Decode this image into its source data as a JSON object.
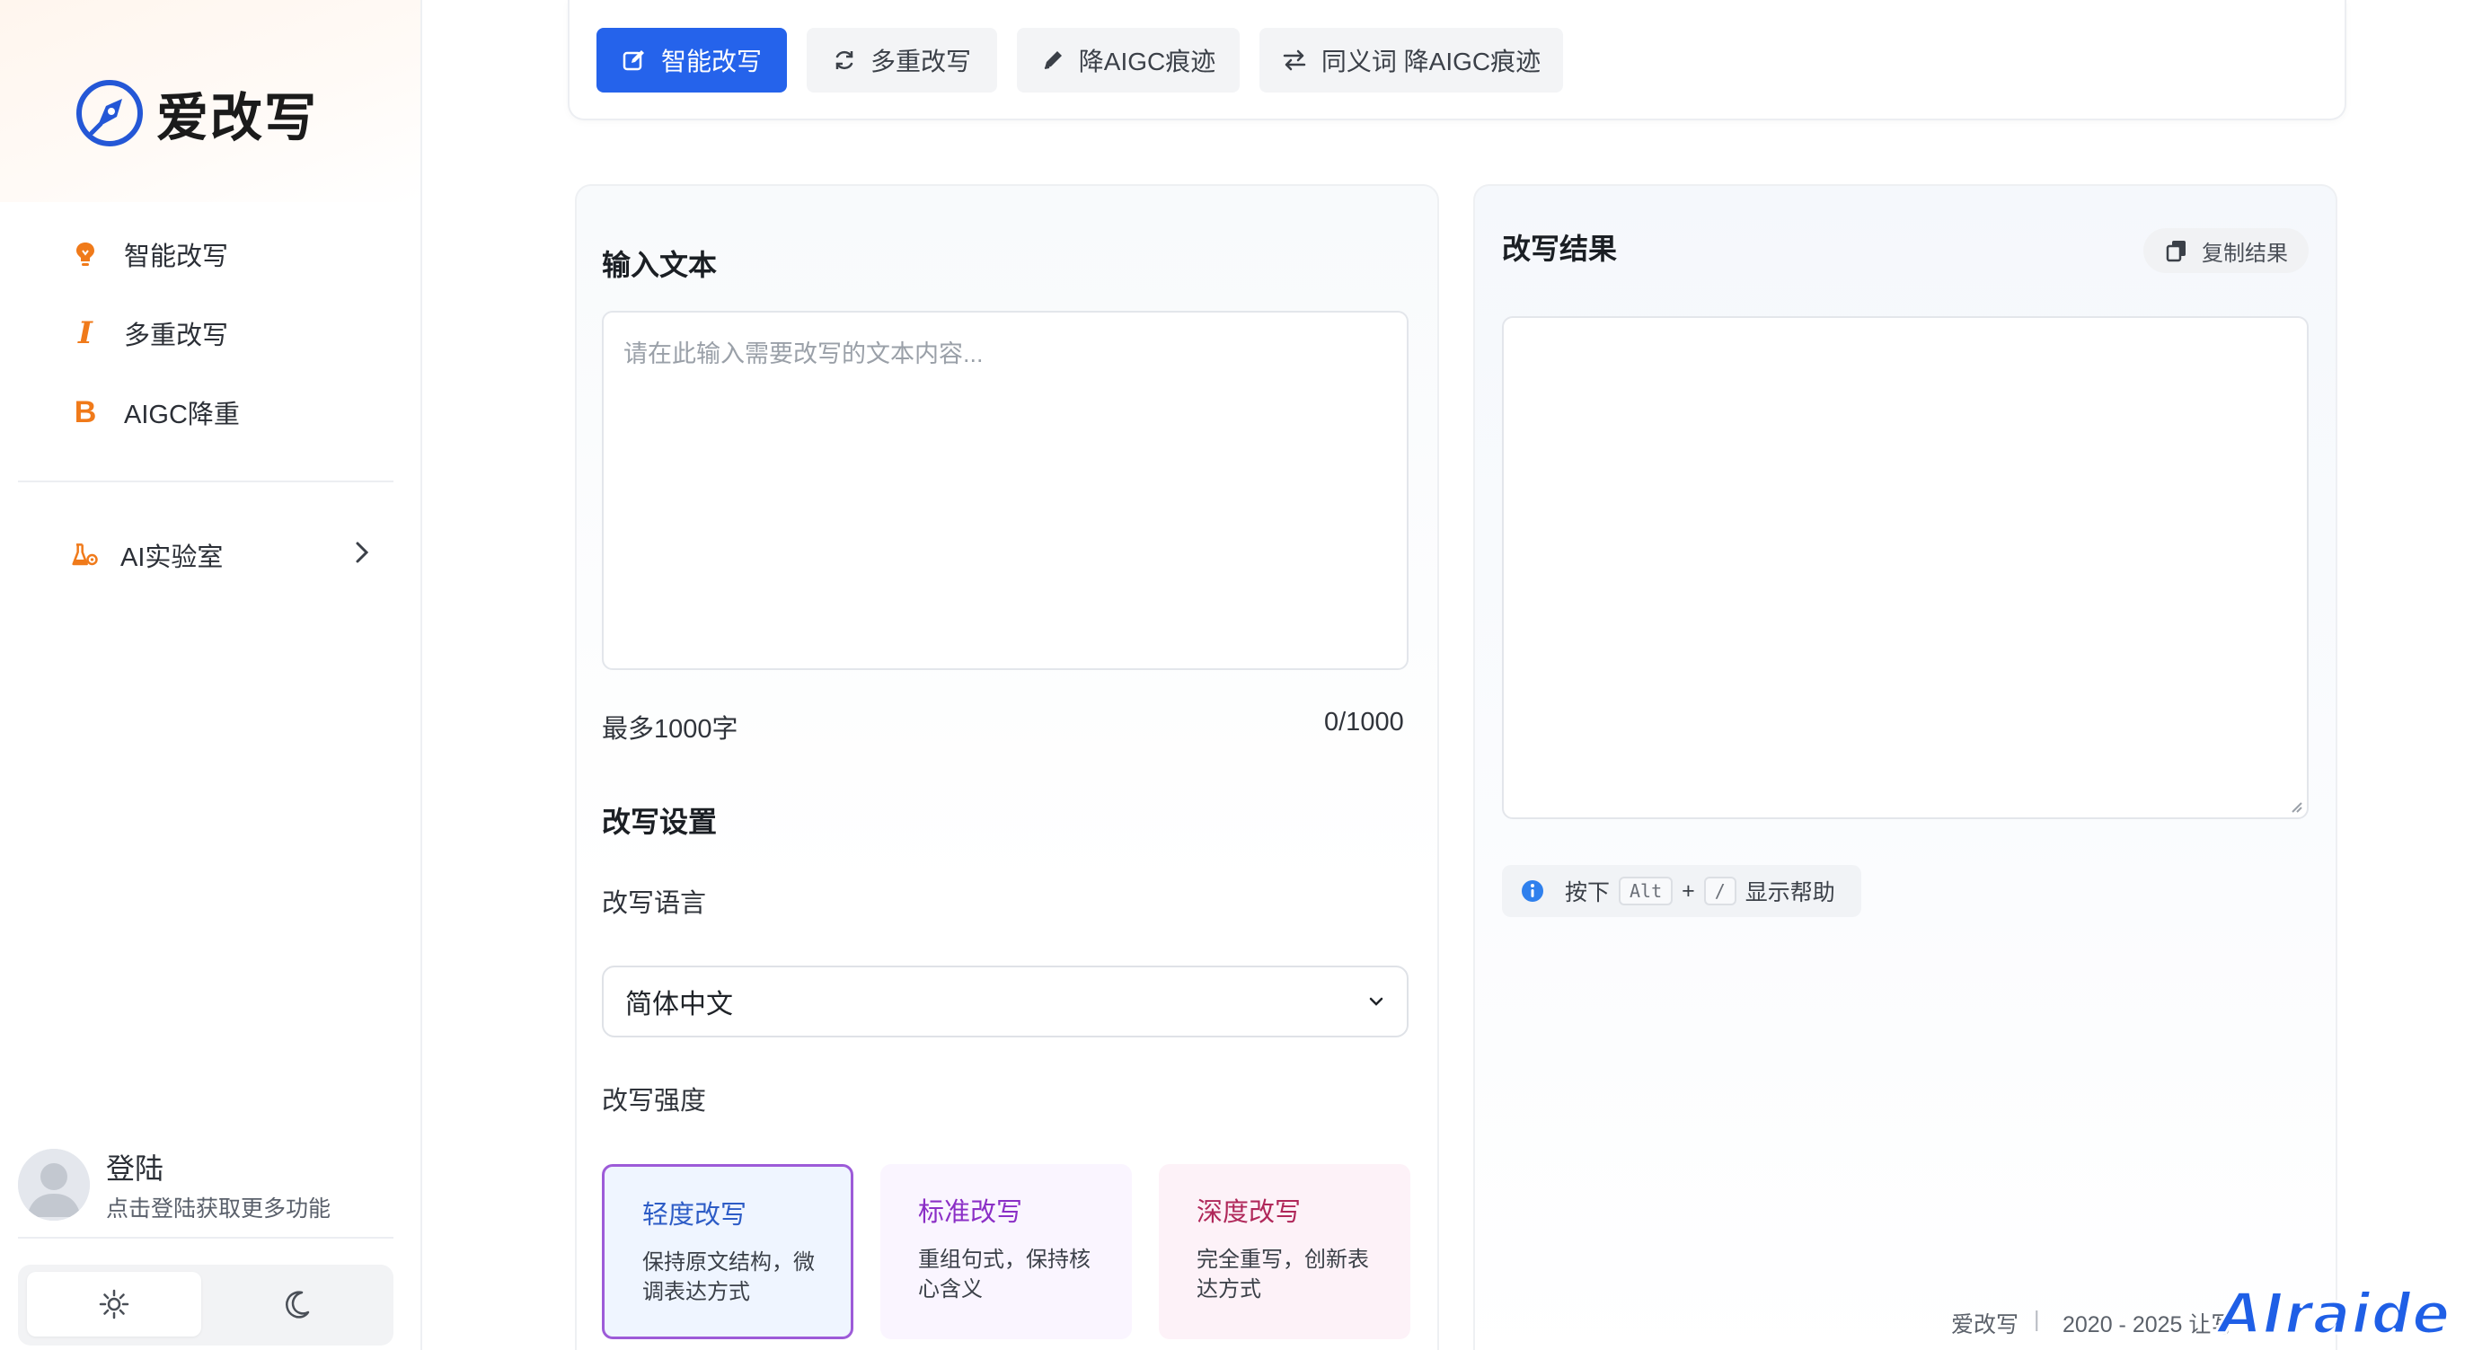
{
  "app": {
    "name": "爱改写",
    "accent_color": "#2563eb",
    "brand_orange": "#f07a1a"
  },
  "sidebar": {
    "items": [
      {
        "label": "智能改写",
        "icon": "lightbulb-icon"
      },
      {
        "label": "多重改写",
        "icon": "italic-icon"
      },
      {
        "label": "AIGC降重",
        "icon": "bold-icon"
      }
    ],
    "lab": {
      "label": "AI实验室",
      "icon": "flask-gear-icon"
    },
    "user": {
      "name": "登陆",
      "subtitle": "点击登陆获取更多功能"
    },
    "theme": {
      "options": [
        "light",
        "dark"
      ],
      "selected": "light"
    }
  },
  "tabs": [
    {
      "label": "智能改写",
      "icon": "edit-icon",
      "active": true
    },
    {
      "label": "多重改写",
      "icon": "refresh-icon",
      "active": false
    },
    {
      "label": "降AIGC痕迹",
      "icon": "pencil-icon",
      "active": false
    },
    {
      "label": "同义词 降AIGC痕迹",
      "icon": "swap-icon",
      "active": false
    }
  ],
  "input": {
    "title": "输入文本",
    "placeholder": "请在此输入需要改写的文本内容...",
    "limit_text": "最多1000字",
    "counter": "0/1000"
  },
  "settings": {
    "title": "改写设置",
    "language_label": "改写语言",
    "language_value": "简体中文",
    "strength_label": "改写强度",
    "strength_options": [
      {
        "title": "轻度改写",
        "desc": "保持原文结构，微调表达方式",
        "selected": true
      },
      {
        "title": "标准改写",
        "desc": "重组句式，保持核心含义",
        "selected": false
      },
      {
        "title": "深度改写",
        "desc": "完全重写，创新表达方式",
        "selected": false
      }
    ]
  },
  "result": {
    "title": "改写结果",
    "copy_label": "复制结果",
    "help_prefix": "按下",
    "help_key1": "Alt",
    "help_plus": "+",
    "help_key2": "/",
    "help_suffix": "显示帮助"
  },
  "footer": {
    "brand": "爱改写",
    "separator": "|",
    "copyright": "2020 - 2025 让写"
  },
  "watermark": "AIraide"
}
